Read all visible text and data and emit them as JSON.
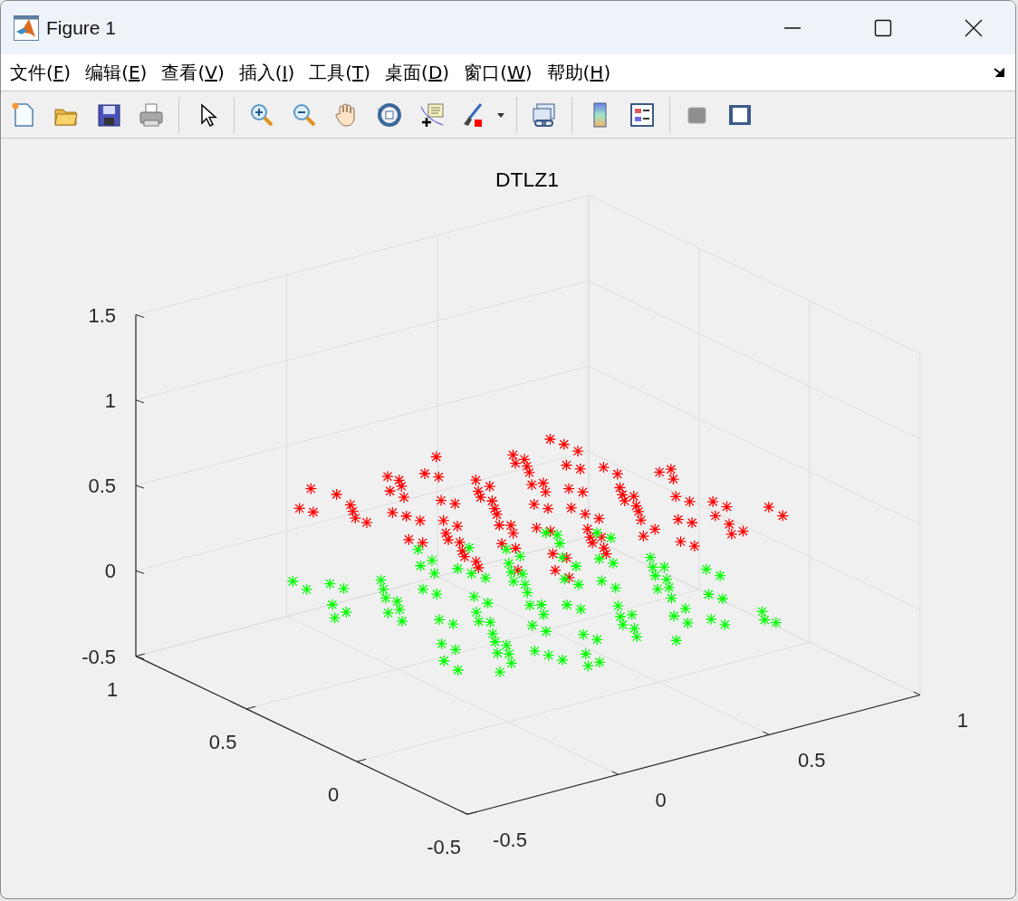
{
  "window": {
    "title": "Figure 1"
  },
  "menu": [
    {
      "before": "文件(",
      "mnemonic": "F",
      "after": ")"
    },
    {
      "before": "编辑(",
      "mnemonic": "E",
      "after": ")"
    },
    {
      "before": "查看(",
      "mnemonic": "V",
      "after": ")"
    },
    {
      "before": "插入(",
      "mnemonic": "I",
      "after": ")"
    },
    {
      "before": "工具(",
      "mnemonic": "T",
      "after": ")"
    },
    {
      "before": "桌面(",
      "mnemonic": "D",
      "after": ")"
    },
    {
      "before": "窗口(",
      "mnemonic": "W",
      "after": ")"
    },
    {
      "before": "帮助(",
      "mnemonic": "H",
      "after": ")"
    }
  ],
  "plot": {
    "title": "DTLZ1",
    "z_ticks": [
      "1.5",
      "1",
      "0.5",
      "0",
      "-0.5"
    ],
    "y_ticks": [
      "1",
      "0.5",
      "0",
      "-0.5"
    ],
    "x_ticks": [
      "-0.5",
      "0",
      "0.5",
      "1"
    ],
    "series": [
      {
        "color": "#ff0000"
      },
      {
        "color": "#00ff00"
      }
    ]
  }
}
